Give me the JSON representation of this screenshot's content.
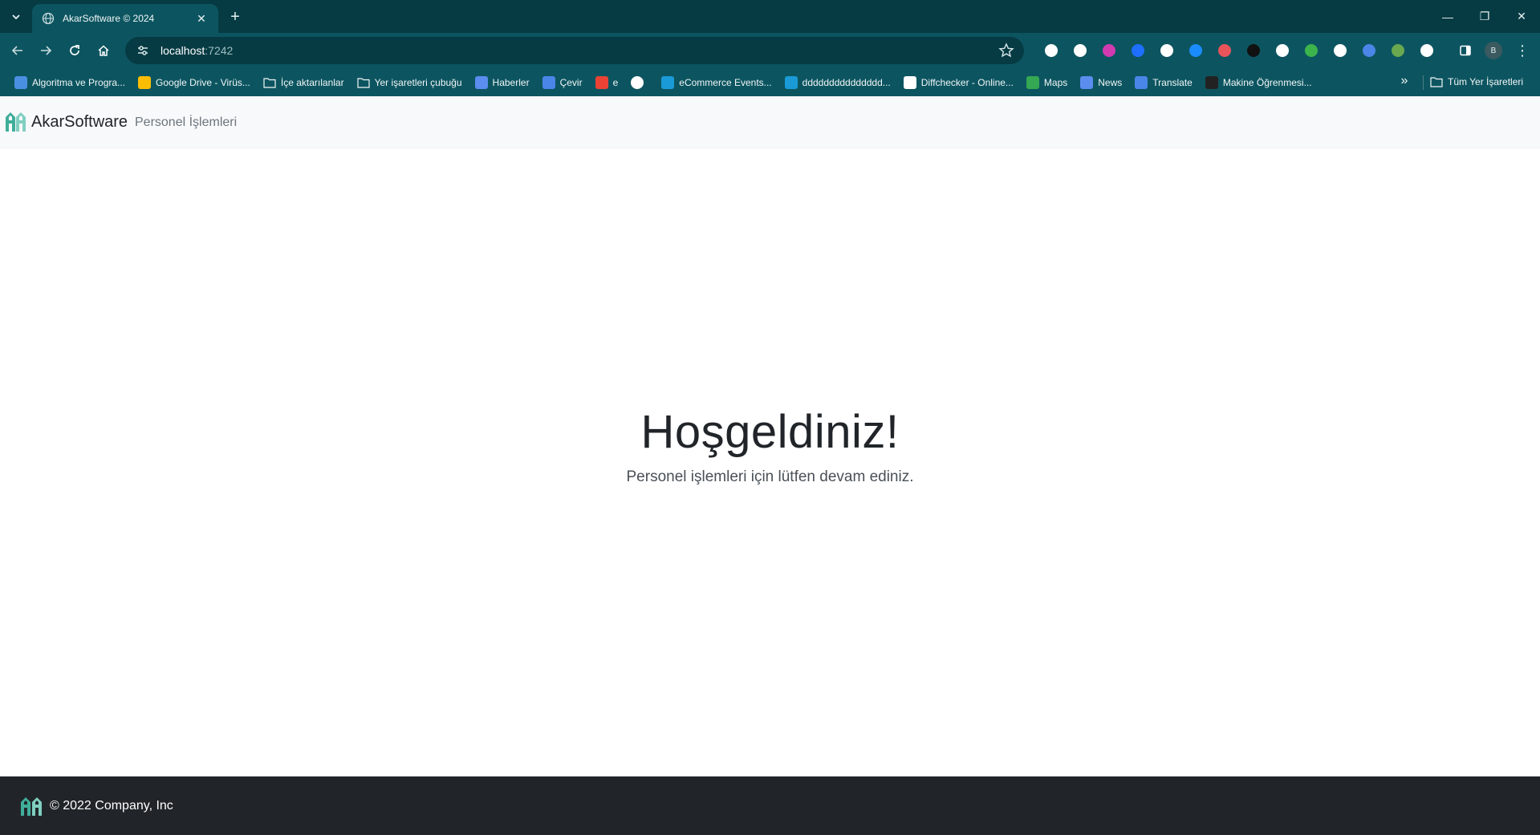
{
  "browser": {
    "tab_title": "AkarSoftware © 2024",
    "url_host": "localhost",
    "url_port": ":7242",
    "profile_initial": "B",
    "extensions": [
      {
        "name": "gauge-extension-icon",
        "color": "#ffffff"
      },
      {
        "name": "circle-extension-icon",
        "color": "#ffffff"
      },
      {
        "name": "play-extension-icon",
        "color": "#d23ab0"
      },
      {
        "name": "f-extension-icon",
        "color": "#1e6fff"
      },
      {
        "name": "atom-extension-icon",
        "color": "#ffffff"
      },
      {
        "name": "shazam-extension-icon",
        "color": "#1a8cff"
      },
      {
        "name": "red-extension-icon",
        "color": "#e8545a"
      },
      {
        "name": "dark-extension-icon",
        "color": "#111111"
      },
      {
        "name": "printer-extension-icon",
        "color": "#ffffff"
      },
      {
        "name": "color-extension-icon",
        "color": "#3cb44b"
      },
      {
        "name": "camera-extension-icon",
        "color": "#ffffff"
      },
      {
        "name": "translate-extension-icon",
        "color": "#4a86e8"
      },
      {
        "name": "green-extension-icon",
        "color": "#6aa84f"
      },
      {
        "name": "puzzle-extension-icon",
        "color": "#ffffff"
      }
    ],
    "bookmarks": [
      {
        "label": "Algoritma ve Progra...",
        "icon": "pen-icon",
        "color": "#4a90e2"
      },
      {
        "label": "Google Drive - Virüs...",
        "icon": "drive-icon",
        "color": "#fbbc04"
      },
      {
        "label": "İçe aktarılanlar",
        "icon": "folder-icon",
        "color": "folder"
      },
      {
        "label": "Yer işaretleri çubuğu",
        "icon": "folder-icon",
        "color": "folder"
      },
      {
        "label": "Haberler",
        "icon": "news-icon",
        "color": "#5b8def"
      },
      {
        "label": "Çevir",
        "icon": "translate-icon",
        "color": "#4a86e8"
      },
      {
        "label": "e",
        "icon": "mail-icon",
        "color": "#ea4335"
      },
      {
        "label": "",
        "icon": "globe-icon",
        "color": "#ffffff"
      },
      {
        "label": "eCommerce Events...",
        "icon": "k-icon",
        "color": "#1a9bd7"
      },
      {
        "label": "ddddddddddddddd...",
        "icon": "k-icon",
        "color": "#1a9bd7"
      },
      {
        "label": "Diffchecker - Online...",
        "icon": "d-icon",
        "color": "#ffffff"
      },
      {
        "label": "Maps",
        "icon": "maps-icon",
        "color": "#34a853"
      },
      {
        "label": "News",
        "icon": "news-icon",
        "color": "#5b8def"
      },
      {
        "label": "Translate",
        "icon": "translate-icon",
        "color": "#4a86e8"
      },
      {
        "label": "Makine Öğrenmesi...",
        "icon": "wordpress-icon",
        "color": "#222222"
      }
    ],
    "all_bookmarks_label": "Tüm Yer İşaretleri"
  },
  "site": {
    "brand": "AkarSoftware",
    "nav_link": "Personel İşlemleri",
    "brand_color": "#3fae9a"
  },
  "hero": {
    "title": "Hoşgeldiniz!",
    "subtitle": "Personel işlemleri için lütfen devam ediniz."
  },
  "footer": {
    "text": "© 2022 Company, Inc"
  }
}
